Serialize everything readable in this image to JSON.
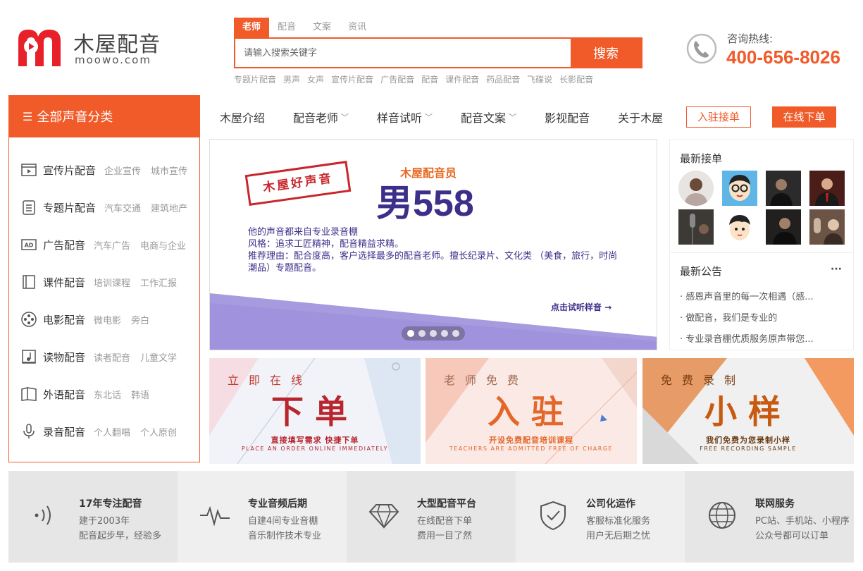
{
  "header": {
    "logo_title": "木屋配音",
    "logo_sub": "moowo.com",
    "search_tabs": [
      {
        "label": "老师",
        "active": true
      },
      {
        "label": "配音",
        "active": false
      },
      {
        "label": "文案",
        "active": false
      },
      {
        "label": "资讯",
        "active": false
      }
    ],
    "search_placeholder": "请输入搜索关键字",
    "search_button": "搜索",
    "hot_words": [
      "专题片配音",
      "男声",
      "女声",
      "宣传片配音",
      "广告配音",
      "配音",
      "课件配音",
      "药品配音",
      "飞碟说",
      "长影配音"
    ],
    "hotline_label": "咨询热线:",
    "hotline_number": "400-656-8026",
    "icon": "phone-icon"
  },
  "categories": {
    "title": "全部声音分类",
    "items": [
      {
        "label": "宣传片配音",
        "subs": [
          "企业宣传",
          "城市宣传"
        ],
        "icon": "film-icon"
      },
      {
        "label": "专题片配音",
        "subs": [
          "汽车交通",
          "建筑地产"
        ],
        "icon": "document-icon"
      },
      {
        "label": "广告配音",
        "subs": [
          "汽车广告",
          "电商与企业"
        ],
        "icon": "ad-icon"
      },
      {
        "label": "课件配音",
        "subs": [
          "培训课程",
          "工作汇报"
        ],
        "icon": "book-icon"
      },
      {
        "label": "电影配音",
        "subs": [
          "微电影",
          "旁白"
        ],
        "icon": "film-reel-icon"
      },
      {
        "label": "读物配音",
        "subs": [
          "读者配音",
          "儿童文学"
        ],
        "icon": "music-note-icon"
      },
      {
        "label": "外语配音",
        "subs": [
          "东北话",
          "韩语"
        ],
        "icon": "open-book-icon"
      },
      {
        "label": "录音配音",
        "subs": [
          "个人翻唱",
          "个人原创"
        ],
        "icon": "microphone-icon"
      }
    ]
  },
  "nav": {
    "items": [
      {
        "label": "木屋介绍",
        "dropdown": false
      },
      {
        "label": "配音老师",
        "dropdown": true
      },
      {
        "label": "样音试听",
        "dropdown": true
      },
      {
        "label": "配音文案",
        "dropdown": true
      },
      {
        "label": "影视配音",
        "dropdown": false
      },
      {
        "label": "关于木屋",
        "dropdown": false
      }
    ],
    "join_button": "入驻接单",
    "order_button": "在线下单"
  },
  "banner": {
    "stamp": "木屋好声音",
    "role": "木屋配音员",
    "name": "男558",
    "desc_lines": [
      "他的声音都来自专业录音棚",
      "风格：追求工匠精神，配音精益求精。",
      "推荐理由：配合度高，客户选择最多的配音老师。擅长纪录片、文化类 （美食，旅行，时尚潮品）专题配音。"
    ],
    "link": "点击试听样音 →",
    "slide_count": 5,
    "active_slide": 0
  },
  "latest_orders": {
    "title": "最新接单",
    "avatar_count": 8
  },
  "announcements": {
    "title": "最新公告",
    "more": "···",
    "items": [
      "· 感恩声音里的每一次相遇（感...",
      "· 做配音，我们是专业的",
      "· 专业录音棚优质服务原声带您..."
    ]
  },
  "promos": [
    {
      "top": "立即在线",
      "big": "下单",
      "cn": "直接填写需求 快捷下单",
      "en": "PLACE AN ORDER ONLINE IMMEDIATELY"
    },
    {
      "top": "老师免费",
      "big": "入驻",
      "cn": "开设免费配音培训课程",
      "en": "TEACHERS ARE ADMITTED FREE OF CHARGE"
    },
    {
      "top": "免费录制",
      "big": "小样",
      "cn": "我们免费为您录制小样",
      "en": "FREE RECORDING SAMPLE"
    }
  ],
  "features": [
    {
      "title": "17年专注配音",
      "lines": [
        "建于2003年",
        "配音起步早，经验多"
      ],
      "icon": "sound-wave-icon"
    },
    {
      "title": "专业音频后期",
      "lines": [
        "自建4间专业音棚",
        "音乐制作技术专业"
      ],
      "icon": "pulse-icon"
    },
    {
      "title": "大型配音平台",
      "lines": [
        "在线配音下单",
        "费用一目了然"
      ],
      "icon": "diamond-icon"
    },
    {
      "title": "公司化运作",
      "lines": [
        "客服标准化服务",
        "用户无后期之忧"
      ],
      "icon": "shield-check-icon"
    },
    {
      "title": "联网服务",
      "lines": [
        "PC站、手机站、小程序",
        "公众号都可以订单"
      ],
      "icon": "globe-icon"
    }
  ],
  "colors": {
    "accent": "#f15a29",
    "banner_purple": "#3b2f8a"
  }
}
